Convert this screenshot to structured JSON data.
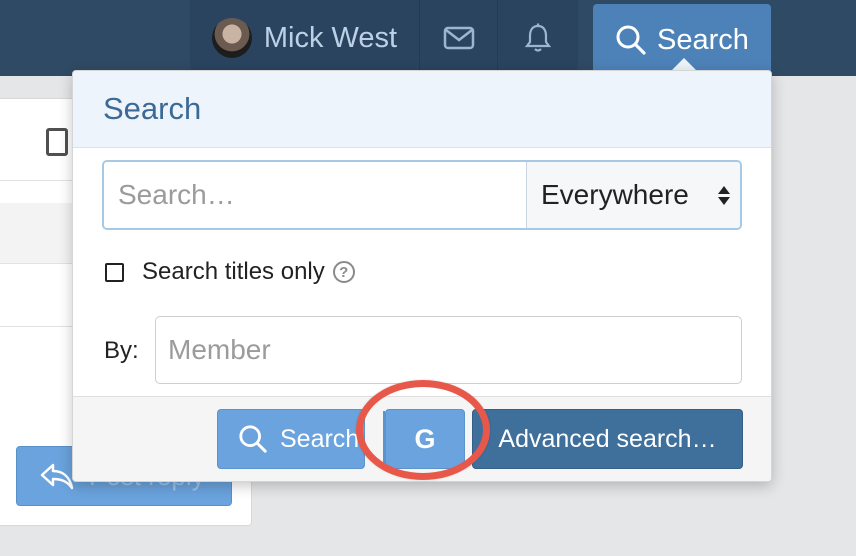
{
  "header": {
    "user_name": "Mick West",
    "search_tab_label": "Search",
    "icons": {
      "user": "avatar",
      "mail": "envelope-icon",
      "bell": "bell-icon",
      "search": "search-icon"
    }
  },
  "background": {
    "reply_button_label": "Post reply"
  },
  "popup": {
    "title": "Search",
    "search_placeholder": "Search…",
    "scope_selected": "Everywhere",
    "titles_only_label": "Search titles only",
    "by_label": "By:",
    "member_placeholder": "Member",
    "search_button_label": "Search",
    "google_button_label": "G",
    "advanced_button_label": "Advanced search…"
  },
  "colors": {
    "topbar": "#2f4a64",
    "accent": "#4d82b8",
    "button_primary": "#6aa3dd",
    "button_dark": "#3f6f9b",
    "annotation_ring": "#e8584a"
  }
}
